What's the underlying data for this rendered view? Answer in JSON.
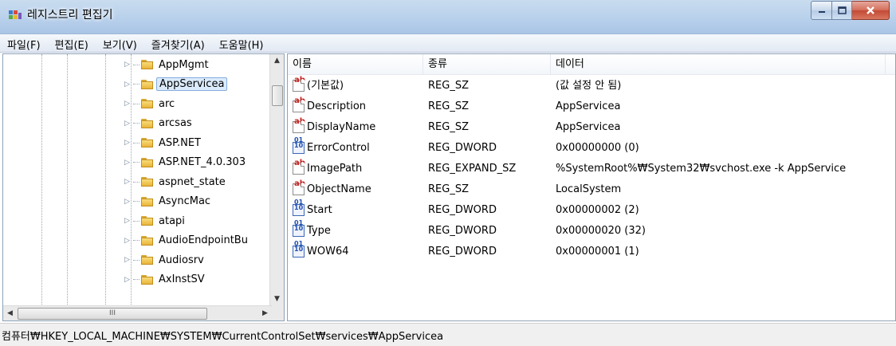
{
  "window": {
    "title": "레지스트리 편집기"
  },
  "menu": [
    "파일(F)",
    "편집(E)",
    "보기(V)",
    "즐겨찾기(A)",
    "도움말(H)"
  ],
  "tree": {
    "items": [
      {
        "label": "AppMgmt",
        "selected": false
      },
      {
        "label": "AppServicea",
        "selected": true
      },
      {
        "label": "arc",
        "selected": false
      },
      {
        "label": "arcsas",
        "selected": false
      },
      {
        "label": "ASP.NET",
        "selected": false
      },
      {
        "label": "ASP.NET_4.0.303",
        "selected": false
      },
      {
        "label": "aspnet_state",
        "selected": false
      },
      {
        "label": "AsyncMac",
        "selected": false
      },
      {
        "label": "atapi",
        "selected": false
      },
      {
        "label": "AudioEndpointBu",
        "selected": false
      },
      {
        "label": "Audiosrv",
        "selected": false
      },
      {
        "label": "AxInstSV",
        "selected": false
      }
    ],
    "hscroll_thumb": "III"
  },
  "list": {
    "columns": [
      "이름",
      "종류",
      "데이터"
    ],
    "rows": [
      {
        "icon": "string-value-icon",
        "name": "(기본값)",
        "type": "REG_SZ",
        "data": "(값 설정 안 됨)"
      },
      {
        "icon": "string-value-icon",
        "name": "Description",
        "type": "REG_SZ",
        "data": "AppServicea"
      },
      {
        "icon": "string-value-icon",
        "name": "DisplayName",
        "type": "REG_SZ",
        "data": "AppServicea"
      },
      {
        "icon": "binary-value-icon",
        "name": "ErrorControl",
        "type": "REG_DWORD",
        "data": "0x00000000 (0)"
      },
      {
        "icon": "string-value-icon",
        "name": "ImagePath",
        "type": "REG_EXPAND_SZ",
        "data": "%SystemRoot%₩System32₩svchost.exe -k AppService"
      },
      {
        "icon": "string-value-icon",
        "name": "ObjectName",
        "type": "REG_SZ",
        "data": "LocalSystem"
      },
      {
        "icon": "binary-value-icon",
        "name": "Start",
        "type": "REG_DWORD",
        "data": "0x00000002 (2)"
      },
      {
        "icon": "binary-value-icon",
        "name": "Type",
        "type": "REG_DWORD",
        "data": "0x00000020 (32)"
      },
      {
        "icon": "binary-value-icon",
        "name": "WOW64",
        "type": "REG_DWORD",
        "data": "0x00000001 (1)"
      }
    ]
  },
  "status": {
    "path": "컴퓨터₩HKEY_LOCAL_MACHINE₩SYSTEM₩CurrentControlSet₩services₩AppServicea"
  }
}
